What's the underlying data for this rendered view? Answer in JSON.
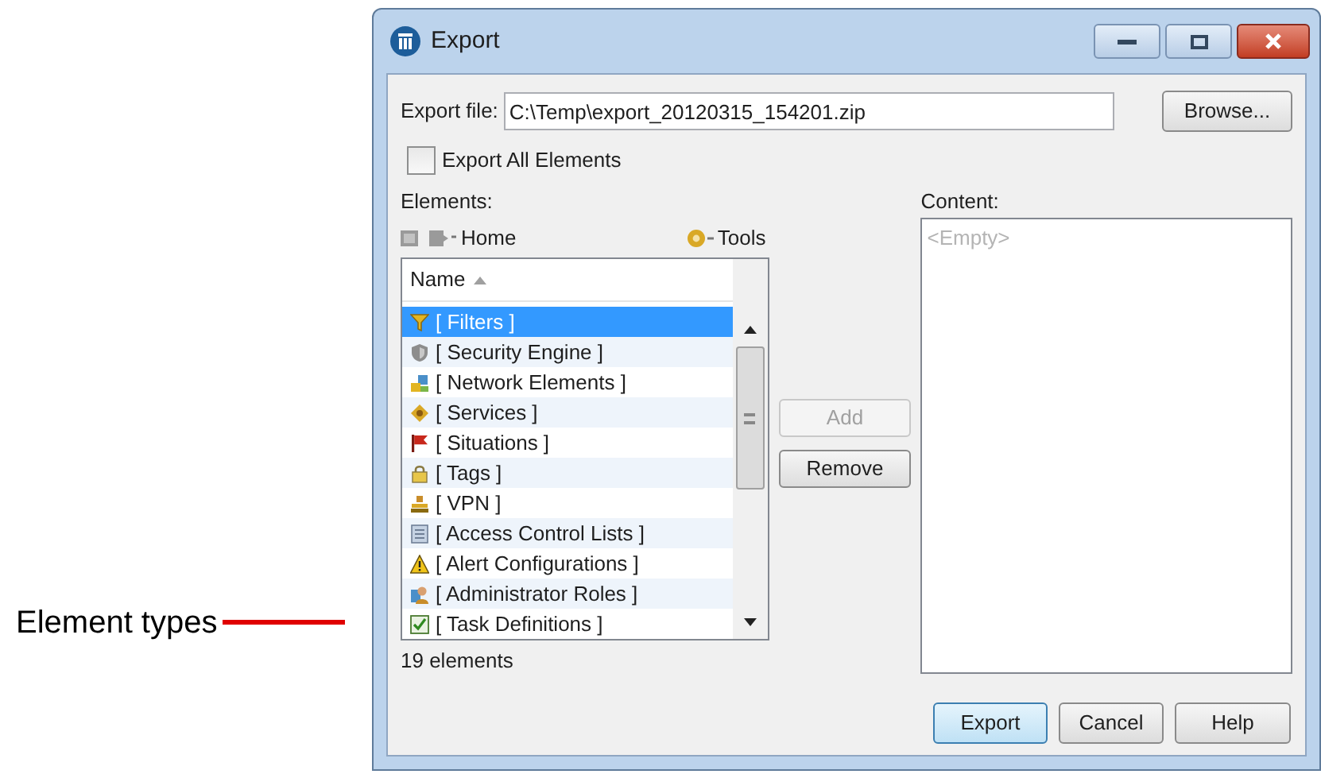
{
  "annotation": {
    "label": "Element types"
  },
  "window": {
    "title": "Export"
  },
  "export_file": {
    "label": "Export file:",
    "value": "C:\\Temp\\export_20120315_154201.zip",
    "browse": {
      "label": "Browse..."
    }
  },
  "export_all": {
    "label": "Export All Elements",
    "checked": false
  },
  "elements": {
    "label": "Elements:",
    "toolbar": {
      "home": "Home",
      "tools": "Tools"
    },
    "column": "Name",
    "rows": [
      {
        "label": "[ Filters ]",
        "selected": true
      },
      {
        "label": "[ Security Engine ]",
        "selected": false
      },
      {
        "label": "[ Network Elements ]",
        "selected": false
      },
      {
        "label": "[ Services ]",
        "selected": false
      },
      {
        "label": "[ Situations ]",
        "selected": false
      },
      {
        "label": "[ Tags ]",
        "selected": false
      },
      {
        "label": "[ VPN ]",
        "selected": false
      },
      {
        "label": "[ Access Control Lists ]",
        "selected": false
      },
      {
        "label": "[ Alert Configurations ]",
        "selected": false
      },
      {
        "label": "[ Administrator Roles ]",
        "selected": false
      },
      {
        "label": "[ Task Definitions ]",
        "selected": false
      }
    ],
    "count": "19 elements"
  },
  "add": {
    "label": "Add",
    "disabled": true
  },
  "remove": {
    "label": "Remove",
    "disabled": false
  },
  "content": {
    "label": "Content:",
    "placeholder": "<Empty>"
  },
  "buttons": [
    {
      "label": "Export",
      "default": true
    },
    {
      "label": "Cancel",
      "default": false
    },
    {
      "label": "Help",
      "default": false
    }
  ]
}
